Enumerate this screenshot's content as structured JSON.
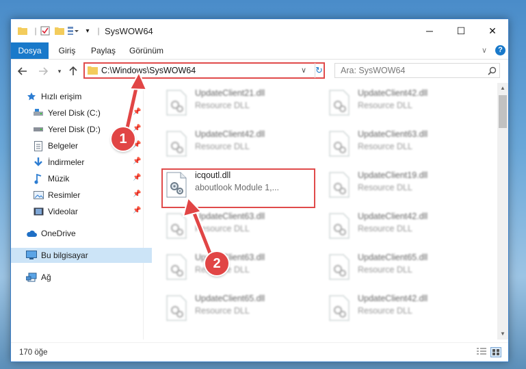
{
  "window": {
    "title": "SysWOW64",
    "controls": {
      "minimize": "─",
      "maximize": "☐",
      "close": "✕"
    }
  },
  "ribbon": {
    "tabs": [
      "Dosya",
      "Giriş",
      "Paylaş",
      "Görünüm"
    ],
    "active_tab": "Dosya"
  },
  "address_bar": {
    "path": "C:\\Windows\\SysWOW64"
  },
  "search": {
    "placeholder": "Ara: SysWOW64"
  },
  "sidebar": {
    "items": [
      {
        "label": "Hızlı erişim",
        "icon": "star-icon",
        "pinned": false
      },
      {
        "label": "Yerel Disk (C:)",
        "icon": "drive-icon",
        "pinned": true
      },
      {
        "label": "Yerel Disk (D:)",
        "icon": "drive-icon",
        "pinned": true
      },
      {
        "label": "Belgeler",
        "icon": "document-icon",
        "pinned": true
      },
      {
        "label": "İndirmeler",
        "icon": "download-icon",
        "pinned": true
      },
      {
        "label": "Müzik",
        "icon": "music-icon",
        "pinned": true
      },
      {
        "label": "Resimler",
        "icon": "pictures-icon",
        "pinned": true
      },
      {
        "label": "Videolar",
        "icon": "video-icon",
        "pinned": true
      },
      {
        "label": "OneDrive",
        "icon": "cloud-icon",
        "pinned": false
      },
      {
        "label": "Bu bilgisayar",
        "icon": "computer-icon",
        "pinned": false,
        "selected": true
      },
      {
        "label": "Ağ",
        "icon": "network-icon",
        "pinned": false
      }
    ]
  },
  "files": {
    "left_column": [
      {
        "name": "UpdateClient21.dll",
        "desc": "Resource DLL"
      },
      {
        "name": "UpdateClient42.dll",
        "desc": "Resource DLL"
      },
      {
        "name": "icqoutl.dll",
        "desc": "aboutlook Module 1,...",
        "highlighted": true
      },
      {
        "name": "UpdateClient63.dll",
        "desc": "Resource DLL"
      },
      {
        "name": "UpdateClient63.dll",
        "desc": "Resource DLL"
      },
      {
        "name": "UpdateClient65.dll",
        "desc": "Resource DLL"
      }
    ],
    "right_column": [
      {
        "name": "UpdateClient42.dll",
        "desc": "Resource DLL"
      },
      {
        "name": "UpdateClient63.dll",
        "desc": "Resource DLL"
      },
      {
        "name": "UpdateClient19.dll",
        "desc": "Resource DLL"
      },
      {
        "name": "UpdateClient42.dll",
        "desc": "Resource DLL"
      },
      {
        "name": "UpdateClient65.dll",
        "desc": "Resource DLL"
      },
      {
        "name": "UpdateClient42.dll",
        "desc": "Resource DLL"
      }
    ]
  },
  "status_bar": {
    "item_count": "170 öğe"
  },
  "callouts": [
    "1",
    "2"
  ],
  "colors": {
    "accent": "#1979ca",
    "highlight_red": "#e04a4a",
    "selection": "#cce4f7"
  }
}
